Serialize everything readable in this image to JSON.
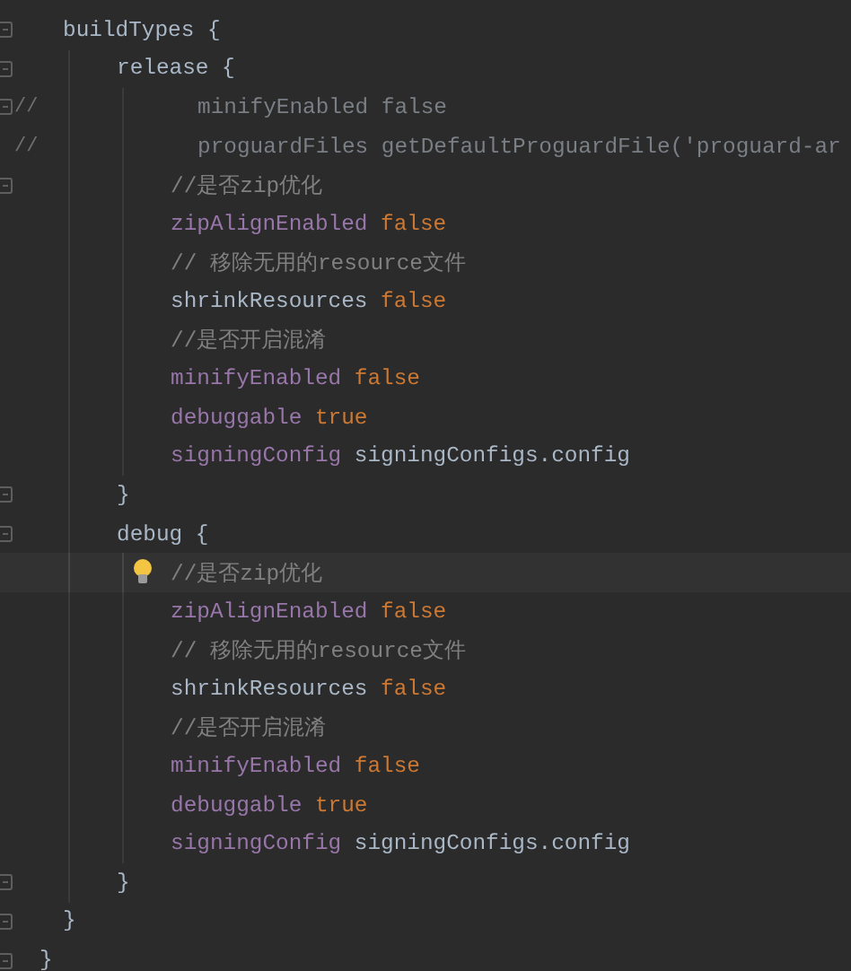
{
  "editor": {
    "lines": [
      {
        "fold": true,
        "current": false,
        "tokens": [
          {
            "kind": "plain",
            "text": "buildTypes {"
          }
        ],
        "children": [
          {
            "fold": true,
            "current": false,
            "tokens": [
              {
                "kind": "plain",
                "text": "release {"
              }
            ],
            "children": [
              {
                "fold": true,
                "gutter": "//",
                "current": false,
                "tokens": [
                  {
                    "kind": "commented",
                    "text": "minifyEnabled false"
                  }
                ]
              },
              {
                "fold": false,
                "gutter": "//",
                "current": false,
                "tokens": [
                  {
                    "kind": "commented",
                    "text": "proguardFiles getDefaultProguardFile('proguard-ar"
                  }
                ]
              },
              {
                "fold": true,
                "current": false,
                "tokens": [
                  {
                    "kind": "comment",
                    "text": "//是否zip优化"
                  }
                ]
              },
              {
                "fold": false,
                "current": false,
                "tokens": [
                  {
                    "kind": "property",
                    "text": "zipAlignEnabled"
                  },
                  {
                    "kind": "literal",
                    "text": "false"
                  }
                ]
              },
              {
                "fold": false,
                "current": false,
                "tokens": [
                  {
                    "kind": "comment",
                    "text": "// 移除无用的resource文件"
                  }
                ]
              },
              {
                "fold": false,
                "current": false,
                "tokens": [
                  {
                    "kind": "plain",
                    "text": "shrinkResources"
                  },
                  {
                    "kind": "literal",
                    "text": "false"
                  }
                ]
              },
              {
                "fold": false,
                "current": false,
                "tokens": [
                  {
                    "kind": "comment",
                    "text": "//是否开启混淆"
                  }
                ]
              },
              {
                "fold": false,
                "current": false,
                "tokens": [
                  {
                    "kind": "property",
                    "text": "minifyEnabled"
                  },
                  {
                    "kind": "literal",
                    "text": "false"
                  }
                ]
              },
              {
                "fold": false,
                "current": false,
                "tokens": [
                  {
                    "kind": "property",
                    "text": "debuggable"
                  },
                  {
                    "kind": "literal",
                    "text": "true"
                  }
                ]
              },
              {
                "fold": false,
                "current": false,
                "tokens": [
                  {
                    "kind": "property",
                    "text": "signingConfig"
                  },
                  {
                    "kind": "plain",
                    "text": "signingConfigs.config"
                  }
                ]
              }
            ]
          },
          {
            "fold": true,
            "current": false,
            "tokens": [
              {
                "kind": "plain",
                "text": "}"
              }
            ]
          },
          {
            "fold": true,
            "current": false,
            "tokens": [
              {
                "kind": "plain",
                "text": "debug {"
              }
            ],
            "children": [
              {
                "fold": false,
                "current": true,
                "tokens": [
                  {
                    "kind": "comment",
                    "text": "//是否zip优化"
                  }
                ]
              },
              {
                "fold": false,
                "current": false,
                "tokens": [
                  {
                    "kind": "property",
                    "text": "zipAlignEnabled"
                  },
                  {
                    "kind": "literal",
                    "text": "false"
                  }
                ]
              },
              {
                "fold": false,
                "current": false,
                "tokens": [
                  {
                    "kind": "comment",
                    "text": "// 移除无用的resource文件"
                  }
                ]
              },
              {
                "fold": false,
                "current": false,
                "tokens": [
                  {
                    "kind": "plain",
                    "text": "shrinkResources"
                  },
                  {
                    "kind": "literal",
                    "text": "false"
                  }
                ]
              },
              {
                "fold": false,
                "current": false,
                "tokens": [
                  {
                    "kind": "comment",
                    "text": "//是否开启混淆"
                  }
                ]
              },
              {
                "fold": false,
                "current": false,
                "tokens": [
                  {
                    "kind": "property",
                    "text": "minifyEnabled"
                  },
                  {
                    "kind": "literal",
                    "text": "false"
                  }
                ]
              },
              {
                "fold": false,
                "current": false,
                "tokens": [
                  {
                    "kind": "property",
                    "text": "debuggable"
                  },
                  {
                    "kind": "literal",
                    "text": "true"
                  }
                ]
              },
              {
                "fold": false,
                "current": false,
                "tokens": [
                  {
                    "kind": "property",
                    "text": "signingConfig"
                  },
                  {
                    "kind": "plain",
                    "text": "signingConfigs.config"
                  }
                ]
              }
            ]
          },
          {
            "fold": true,
            "current": false,
            "tokens": [
              {
                "kind": "plain",
                "text": "}"
              }
            ]
          }
        ]
      },
      {
        "fold": true,
        "current": false,
        "tokens": [
          {
            "kind": "plain",
            "text": "}"
          }
        ]
      }
    ],
    "trailing": {
      "fold": true,
      "current": false,
      "tokens": [
        {
          "kind": "plain",
          "text": "}"
        }
      ]
    }
  }
}
